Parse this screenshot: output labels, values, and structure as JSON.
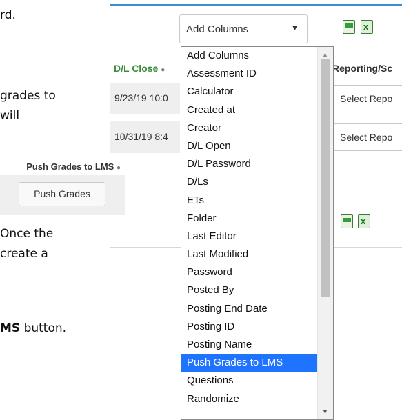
{
  "doc_text": {
    "line1": "rd.",
    "line2": "grades to",
    "line3": "will",
    "line4": "Once the",
    "line5": "create a",
    "line6_bold": "MS",
    "line6_rest": " button."
  },
  "toolbar": {
    "columns_select_value": "Add Columns",
    "csv_icon": "csv-export-icon",
    "xls_icon": "excel-export-icon"
  },
  "table": {
    "dl_close_header": "D/L Close",
    "reporting_header": "Reporting/Sc",
    "rows": [
      {
        "dl_close": "9/23/19 10:0",
        "report_select": "Select Repo"
      },
      {
        "dl_close": "10/31/19 8:4",
        "report_select": "Select Repo"
      }
    ]
  },
  "push_panel": {
    "label": "Push Grades to LMS",
    "button": "Push Grades"
  },
  "dropdown": {
    "items": [
      "Add Columns",
      "Assessment ID",
      "Calculator",
      "Created at",
      "Creator",
      "D/L Open",
      "D/L Password",
      "D/Ls",
      "ETs",
      "Folder",
      "Last Editor",
      "Last Modified",
      "Password",
      "Posted By",
      "Posting End Date",
      "Posting ID",
      "Posting Name",
      "Push Grades to LMS",
      "Questions",
      "Randomize"
    ],
    "selected": "Push Grades to LMS"
  },
  "colors": {
    "accent_blue": "#3b8ed4",
    "selected_item": "#1e74ff",
    "header_green": "#3c8c3c"
  }
}
